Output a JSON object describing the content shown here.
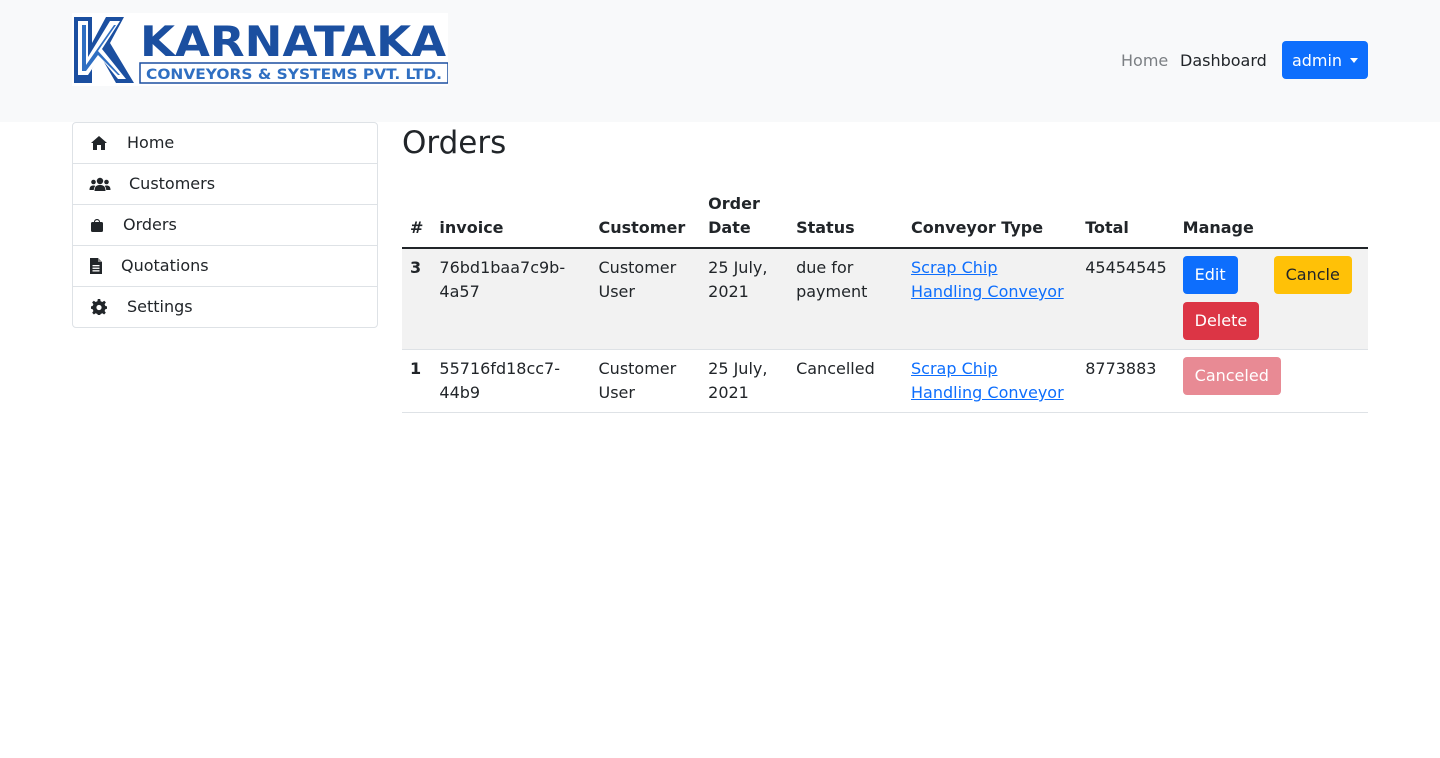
{
  "brand": {
    "name": "KARNATAKA",
    "tagline": "CONVEYORS & SYSTEMS PVT. LTD.",
    "colors": {
      "primary": "#1b4fa0",
      "secondary": "#2f6fc2"
    }
  },
  "navbar": {
    "home": "Home",
    "dashboard": "Dashboard",
    "user_menu": "admin"
  },
  "sidebar": {
    "items": [
      {
        "label": "Home",
        "icon": "home-icon"
      },
      {
        "label": "Customers",
        "icon": "users-icon"
      },
      {
        "label": "Orders",
        "icon": "shopping-bag-icon"
      },
      {
        "label": "Quotations",
        "icon": "file-text-icon"
      },
      {
        "label": "Settings",
        "icon": "gear-icon"
      }
    ]
  },
  "page": {
    "title": "Orders"
  },
  "table": {
    "headers": {
      "num": "#",
      "invoice": "invoice",
      "customer": "Customer",
      "order_date": "Order Date",
      "status": "Status",
      "conveyor_type": "Conveyor Type",
      "total": "Total",
      "manage": "Manage"
    },
    "rows": [
      {
        "num": "3",
        "invoice": "76bd1baa7c9b-4a57",
        "customer": "Customer User",
        "order_date": "25 July, 2021",
        "status": "due for payment",
        "conveyor_type": "Scrap Chip Handling Conveyor",
        "total": "45454545",
        "actions": {
          "edit": "Edit",
          "cancel": "Cancle",
          "delete": "Delete"
        }
      },
      {
        "num": "1",
        "invoice": "55716fd18cc7-44b9",
        "customer": "Customer User",
        "order_date": "25 July, 2021",
        "status": "Cancelled",
        "conveyor_type": "Scrap Chip Handling Conveyor",
        "total": "8773883",
        "actions": {
          "canceled": "Canceled"
        }
      }
    ]
  },
  "colors": {
    "navbar_bg": "#f8f9fa",
    "primary": "#0d6efd",
    "warning": "#ffc107",
    "danger": "#dc3545",
    "stripe": "#f2f2f2"
  }
}
